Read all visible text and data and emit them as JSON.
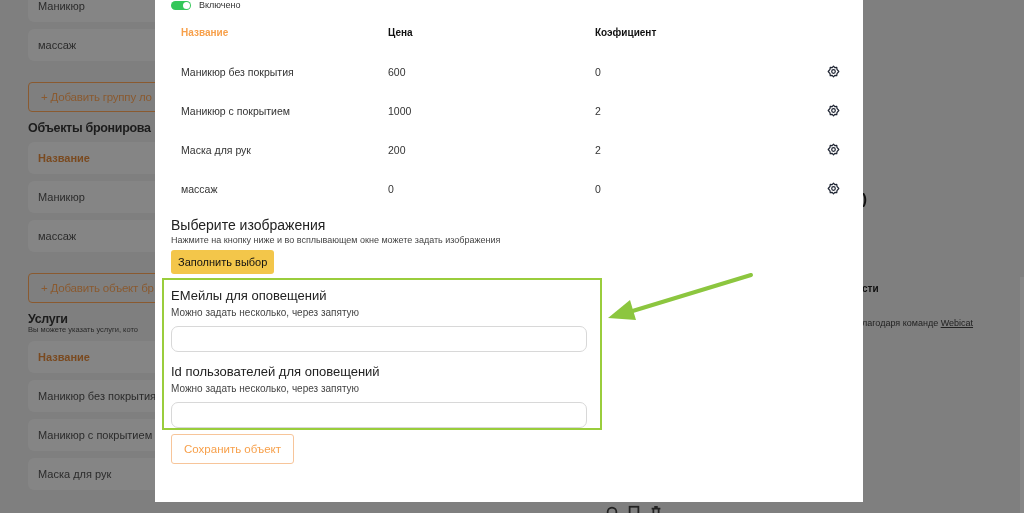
{
  "background_page": {
    "left_items": [
      {
        "kind": "card",
        "label": "Маникюр"
      },
      {
        "kind": "card",
        "label": "массаж"
      },
      {
        "kind": "add",
        "label": "+ Добавить группу ло"
      },
      {
        "kind": "heading",
        "label": "Объекты бронирова"
      },
      {
        "kind": "header",
        "label": "Название"
      },
      {
        "kind": "card",
        "label": "Маникюр"
      },
      {
        "kind": "card",
        "label": "массаж"
      },
      {
        "kind": "add",
        "label": "+ Добавить объект бр"
      },
      {
        "kind": "heading",
        "label": "Услуги"
      },
      {
        "kind": "hint",
        "label": "Вы можете указать услуги, кото"
      },
      {
        "kind": "header",
        "label": "Название"
      },
      {
        "kind": "card",
        "label": "Маникюр без покрытия"
      },
      {
        "kind": "card",
        "label": "Маникюр с покрытием"
      },
      {
        "kind": "card",
        "label": "Маска для рук"
      }
    ],
    "right_texts": [
      {
        "kind": "heading",
        "text": ")"
      },
      {
        "kind": "heading",
        "text": "сти"
      },
      {
        "kind": "credit",
        "text": "лагодаря команде",
        "link": "Webicat"
      }
    ]
  },
  "modal": {
    "toggle": {
      "label": "Включено",
      "on": true
    },
    "table": {
      "columns": [
        "Название",
        "Цена",
        "Коэфициент"
      ],
      "rows": [
        {
          "name": "Маникюр без покрытия",
          "price": "600",
          "coef": "0"
        },
        {
          "name": "Маникюр с покрытием",
          "price": "1000",
          "coef": "2"
        },
        {
          "name": "Маска для рук",
          "price": "200",
          "coef": "2"
        },
        {
          "name": "массаж",
          "price": "0",
          "coef": "0"
        }
      ]
    },
    "images": {
      "title": "Выберите изображения",
      "hint": "Нажмите на кнопку ниже и во всплывающем окне можете задать изображения",
      "button": "Заполнить выбор"
    },
    "fields": [
      {
        "label": "ЕМейлы для оповещений",
        "hint": "Можно задать несколько, через запятую"
      },
      {
        "label": "Id пользователей для оповещений",
        "hint": "Можно задать несколько, через запятую"
      }
    ],
    "save_button": "Сохранить объект"
  }
}
